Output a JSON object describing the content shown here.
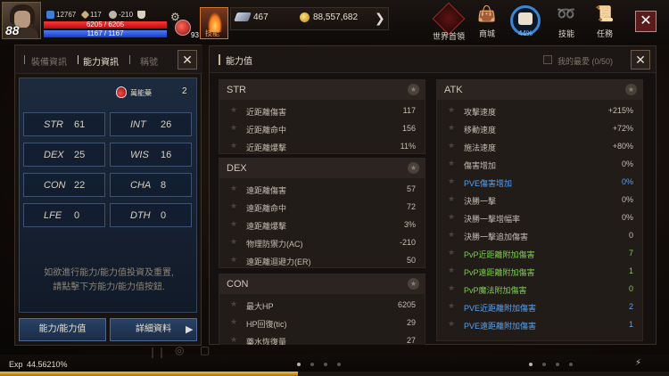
{
  "player": {
    "level": "88",
    "stat_a": "12767",
    "stat_b": "117",
    "stat_c": "-210",
    "hp": "6205 / 6205",
    "hp_fraction": 1.0,
    "mp": "1167 / 1167",
    "mp_fraction": 1.0,
    "potion_count": "93",
    "skill_text": "技能"
  },
  "currency": {
    "gems": "467",
    "gold": "88,557,682"
  },
  "hud": {
    "world_boss": "世界首領",
    "shop": "商城",
    "gauge": "44%",
    "skills": "技能",
    "quests": "任務",
    "close": "✕"
  },
  "left_panel": {
    "tabs": [
      "裝備資訊",
      "能力資訊",
      "稱號"
    ],
    "active_tab": 1,
    "close": "✕",
    "elixir_label": "萬能藥",
    "elixir_count": "2",
    "stats": [
      {
        "name": "STR",
        "value": "61"
      },
      {
        "name": "INT",
        "value": "26"
      },
      {
        "name": "DEX",
        "value": "25"
      },
      {
        "name": "WIS",
        "value": "16"
      },
      {
        "name": "CON",
        "value": "22"
      },
      {
        "name": "CHA",
        "value": "8"
      },
      {
        "name": "LFE",
        "value": "0"
      },
      {
        "name": "DTH",
        "value": "0"
      }
    ],
    "hint_line1": "如欲進行能力/能力值投資及重置,",
    "hint_line2": "請點擊下方能力/能力值按鈕.",
    "btn_reset": "能力/能力值",
    "btn_detail": "詳細資料",
    "btn_detail_arrow": "▶"
  },
  "right_panel": {
    "title": "能力值",
    "favorite_label": "我的最愛 (0/50)",
    "close": "✕",
    "sections": {
      "str": {
        "title": "STR",
        "rows": [
          {
            "label": "近距離傷害",
            "value": "117"
          },
          {
            "label": "近距離命中",
            "value": "156"
          },
          {
            "label": "近距離爆擊",
            "value": "11%"
          }
        ]
      },
      "dex": {
        "title": "DEX",
        "rows": [
          {
            "label": "遠距離傷害",
            "value": "57"
          },
          {
            "label": "遠距離命中",
            "value": "72"
          },
          {
            "label": "遠距離爆擊",
            "value": "3%"
          },
          {
            "label": "物理防禦力(AC)",
            "value": "-210"
          },
          {
            "label": "遠距離迴避力(ER)",
            "value": "50"
          }
        ]
      },
      "con": {
        "title": "CON",
        "rows": [
          {
            "label": "最大HP",
            "value": "6205"
          },
          {
            "label": "HP回復(tic)",
            "value": "29"
          },
          {
            "label": "藥水恢復量",
            "value": "27"
          }
        ]
      },
      "atk": {
        "title": "ATK",
        "rows": [
          {
            "label": "攻擊速度",
            "value": "+215%"
          },
          {
            "label": "移動速度",
            "value": "+72%"
          },
          {
            "label": "施法速度",
            "value": "+80%"
          },
          {
            "label": "傷害增加",
            "value": "0%"
          },
          {
            "label": "PVE傷害增加",
            "value": "0%"
          },
          {
            "label": "決勝一擊",
            "value": "0%"
          },
          {
            "label": "決勝一擊增幅率",
            "value": "0%"
          },
          {
            "label": "決勝一擊追加傷害",
            "value": "0"
          },
          {
            "label": "PvP近距離附加傷害",
            "value": "7"
          },
          {
            "label": "PvP遠距離附加傷害",
            "value": "1"
          },
          {
            "label": "PvP魔法附加傷害",
            "value": "0"
          },
          {
            "label": "PVE近距離附加傷害",
            "value": "2"
          },
          {
            "label": "PVE遠距離附加傷害",
            "value": "1"
          }
        ]
      }
    }
  },
  "bottom": {
    "exp_label": "Exp",
    "exp_value": "44.56210%",
    "exp_fraction": 0.4456
  },
  "colors": {
    "hp": "#d01818",
    "mp": "#2a55e0",
    "green_stat": "#7bd04a",
    "blue_stat": "#4fa3ff",
    "accent_gauge": "#3a86d4"
  }
}
